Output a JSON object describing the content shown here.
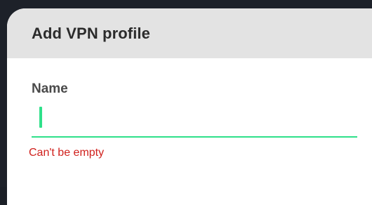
{
  "dialog": {
    "title": "Add VPN profile",
    "name_field": {
      "label": "Name",
      "value": "",
      "error": "Can't be empty"
    }
  },
  "colors": {
    "accent": "#2fe08a",
    "error": "#d0201c",
    "header_bg": "#e3e3e3"
  }
}
